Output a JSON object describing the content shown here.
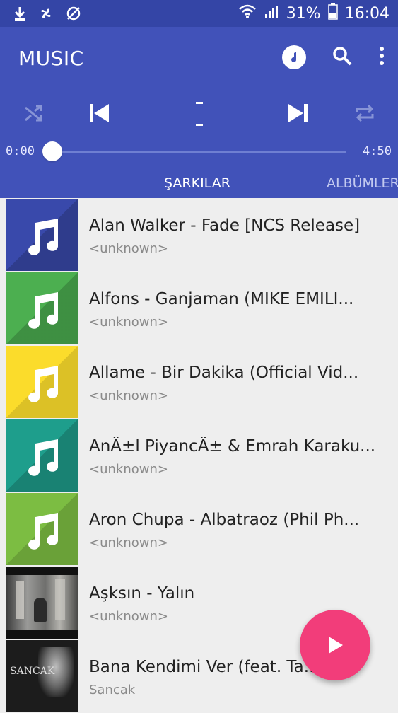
{
  "status_bar": {
    "battery_percent": "31%",
    "time": "16:04",
    "icons": [
      "download-icon",
      "fan-icon",
      "no-sync-icon",
      "wifi-icon",
      "signal-icon",
      "battery-icon"
    ]
  },
  "app_bar": {
    "title": "MUSIC",
    "actions": [
      "music-note-icon",
      "search-icon",
      "more-vert-icon"
    ]
  },
  "player": {
    "controls": [
      "shuffle-icon",
      "skip-previous-icon",
      "pause-icon",
      "skip-next-icon",
      "repeat-icon"
    ],
    "time_elapsed": "0:00",
    "time_total": "4:50",
    "progress": 0.0
  },
  "tabs": [
    {
      "label": "ŞARKILAR",
      "active": true
    },
    {
      "label": "ALBÜMLER",
      "active": false
    }
  ],
  "songs": [
    {
      "title": "Alan Walker - Fade [NCS Release]",
      "artist": "<unknown>",
      "thumb_color": "#3949ab",
      "thumb_type": "note"
    },
    {
      "title": "Alfons - Ganjaman (MIKE EMILI...",
      "artist": "<unknown>",
      "thumb_color": "#4caf50",
      "thumb_type": "note"
    },
    {
      "title": "Allame - Bir Dakika (Official Vid...",
      "artist": "<unknown>",
      "thumb_color": "#fbdc2b",
      "thumb_type": "note"
    },
    {
      "title": "AnÄ±l PiyancÄ± & Emrah Karaku...",
      "artist": "<unknown>",
      "thumb_color": "#1e9e8c",
      "thumb_type": "note"
    },
    {
      "title": "Aron Chupa - Albatraoz (Phil Ph...",
      "artist": "<unknown>",
      "thumb_color": "#7cbd42",
      "thumb_type": "note"
    },
    {
      "title": "Aşksın - Yalın",
      "artist": "<unknown>",
      "thumb_color": "#5b5b5b",
      "thumb_type": "photo"
    },
    {
      "title": "Bana Kendimi Ver (feat. Ta...",
      "artist": "Sancak",
      "thumb_color": "#2a2a2a",
      "thumb_type": "photo",
      "photo_text": "SANCAK"
    }
  ],
  "fab": {
    "icon": "play-icon"
  },
  "colors": {
    "status_bar": "#3445a6",
    "app_bar": "#4152b9",
    "fab": "#f23d7a",
    "background": "#eeeeee"
  }
}
